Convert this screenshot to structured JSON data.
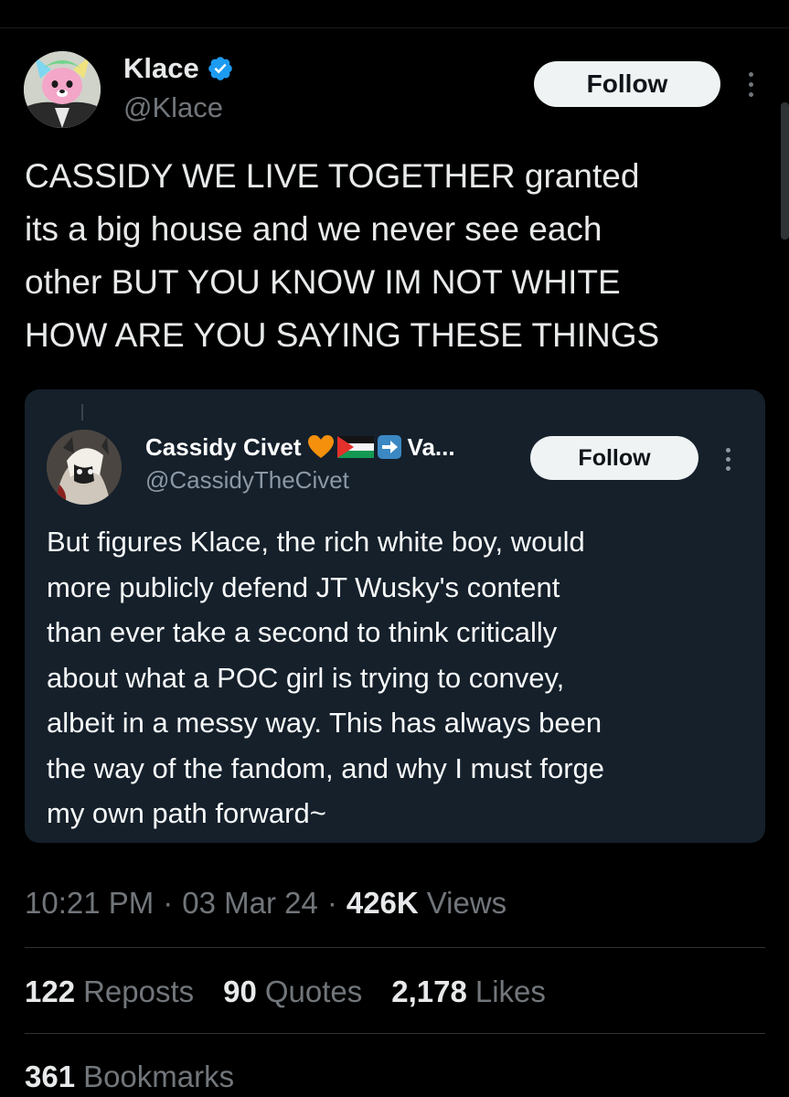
{
  "tweet": {
    "author": {
      "name": "Klace",
      "handle": "@Klace",
      "verified_color": "#1d9bf0"
    },
    "follow_label": "Follow",
    "more_icon": "more-dots-icon",
    "text": "CASSIDY WE LIVE TOGETHER granted\nits a big house and we never see each\nother BUT YOU KNOW IM NOT WHITE\nHOW ARE YOU SAYING THESE THINGS"
  },
  "quote": {
    "author": {
      "name": "Cassidy Civet",
      "name_suffix": "Va...",
      "emojis": [
        "orange-heart-icon",
        "palestine-flag-icon",
        "right-arrow-icon"
      ],
      "handle": "@CassidyTheCivet"
    },
    "follow_label": "Follow",
    "text": "But figures Klace, the rich white boy, would\nmore publicly defend JT Wusky's content\nthan ever take a second to think critically\nabout what a POC girl is trying to convey,\nalbeit in a messy way. This has always been\nthe way of the fandom, and why I must forge\nmy own path forward~"
  },
  "meta": {
    "time": "10:21 PM",
    "separator": "·",
    "date": "03 Mar 24",
    "views_count": "426K",
    "views_label": "Views"
  },
  "stats": {
    "reposts": {
      "count": "122",
      "label": "Reposts"
    },
    "quotes": {
      "count": "90",
      "label": "Quotes"
    },
    "likes": {
      "count": "2,178",
      "label": "Likes"
    },
    "bookmarks": {
      "count": "361",
      "label": "Bookmarks"
    }
  },
  "colors": {
    "background": "#000000",
    "text_primary": "#e7e9ea",
    "text_secondary": "#71767b",
    "quote_background": "#15202b",
    "button_background": "#eff3f4",
    "verified": "#1d9bf0"
  }
}
